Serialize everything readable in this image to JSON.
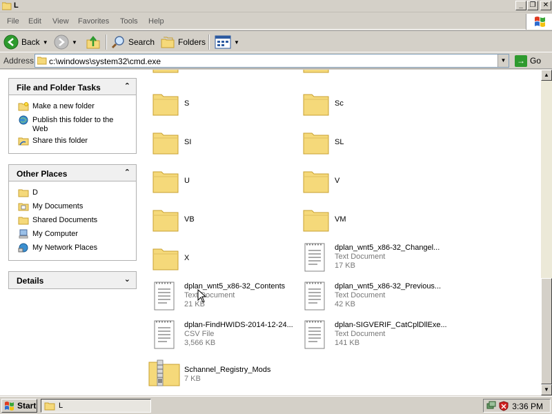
{
  "window": {
    "title": "L",
    "minimize": "_",
    "maximize": "❐",
    "close": "✕"
  },
  "menu": [
    "File",
    "Edit",
    "View",
    "Favorites",
    "Tools",
    "Help"
  ],
  "toolbar": {
    "back": "Back",
    "search": "Search",
    "folders": "Folders"
  },
  "address": {
    "label": "Address",
    "value": "c:\\windows\\system32\\cmd.exe",
    "go": "Go"
  },
  "tasks_panel": {
    "title": "File and Folder Tasks",
    "items": [
      "Make a new folder",
      "Publish this folder to the Web",
      "Share this folder"
    ]
  },
  "places_panel": {
    "title": "Other Places",
    "items": [
      "D",
      "My Documents",
      "Shared Documents",
      "My Computer",
      "My Network Places"
    ]
  },
  "details_panel": {
    "title": "Details"
  },
  "files": [
    {
      "name": "S",
      "kind": "folder"
    },
    {
      "name": "Sc",
      "kind": "folder"
    },
    {
      "name": "SI",
      "kind": "folder"
    },
    {
      "name": "SL",
      "kind": "folder"
    },
    {
      "name": "U",
      "kind": "folder"
    },
    {
      "name": "V",
      "kind": "folder"
    },
    {
      "name": "VB",
      "kind": "folder"
    },
    {
      "name": "VM",
      "kind": "folder"
    },
    {
      "name": "X",
      "kind": "folder"
    },
    {
      "name": "dplan_wnt5_x86-32_Changel...",
      "kind": "doc",
      "type": "Text Document",
      "size": "17 KB"
    },
    {
      "name": "dplan_wnt5_x86-32_Contents",
      "kind": "doc",
      "type": "Text Document",
      "size": "21 KB"
    },
    {
      "name": "dplan_wnt5_x86-32_Previous...",
      "kind": "doc",
      "type": "Text Document",
      "size": "42 KB"
    },
    {
      "name": "dplan-FindHWIDS-2014-12-24...",
      "kind": "doc",
      "type": "CSV File",
      "size": "3,566 KB"
    },
    {
      "name": "dplan-SIGVERIF_CatCplDllExe...",
      "kind": "doc",
      "type": "Text Document",
      "size": "141 KB"
    },
    {
      "name": "Schannel_Registry_Mods",
      "kind": "zip",
      "size": "7 KB"
    }
  ],
  "taskbar": {
    "start": "Start",
    "task": "L",
    "clock": "3:36 PM"
  },
  "colors": {
    "folder": "#f5d97a",
    "folder_edge": "#c8a030",
    "back_green": "#2e9a2e"
  }
}
